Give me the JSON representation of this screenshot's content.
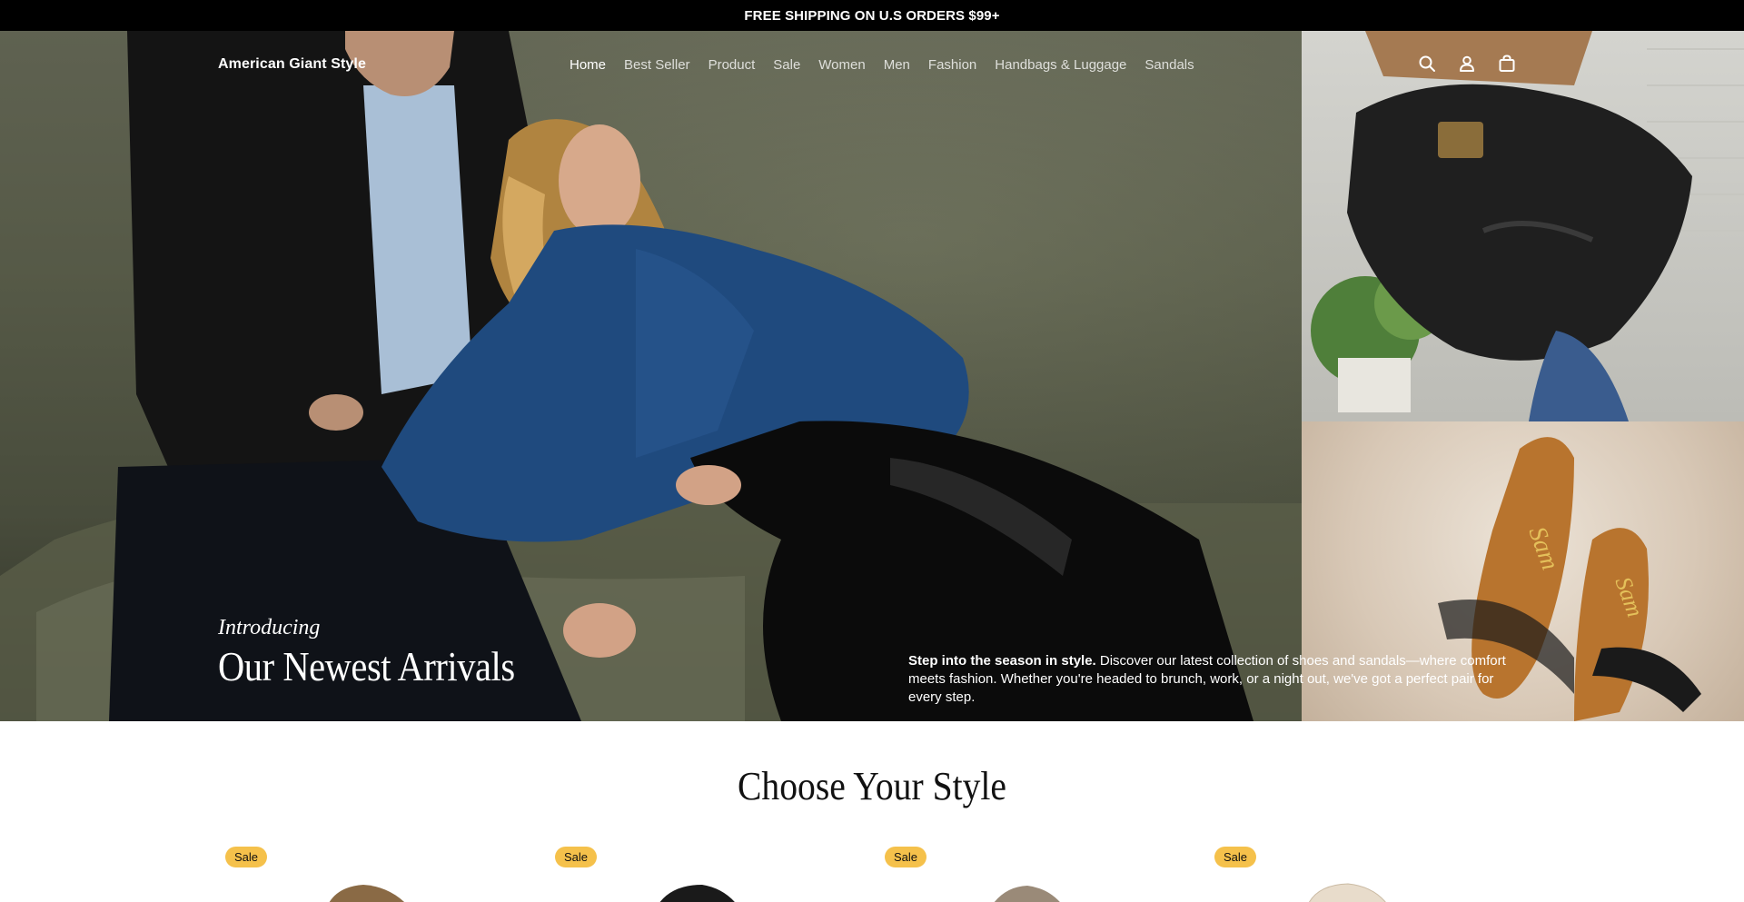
{
  "announcement": "FREE SHIPPING ON U.S ORDERS $99+",
  "brand": "American Giant Style",
  "nav": {
    "items": [
      "Home",
      "Best Seller",
      "Product",
      "Sale",
      "Women",
      "Men",
      "Fashion",
      "Handbags & Luggage",
      "Sandals"
    ],
    "active": "Home",
    "icons": [
      "search-icon",
      "account-icon",
      "cart-icon"
    ]
  },
  "hero": {
    "intro": "Introducing",
    "headline": "Our Newest Arrivals",
    "description_bold": "Step into the season in style.",
    "description": " Discover our latest collection of shoes and sandals—where comfort meets fashion. Whether you're headed to brunch, work, or a night out, we've got a perfect pair for every step."
  },
  "section": {
    "title": "Choose Your Style"
  },
  "products": [
    {
      "badge": "Sale"
    },
    {
      "badge": "Sale"
    },
    {
      "badge": "Sale"
    },
    {
      "badge": "Sale"
    }
  ],
  "colors": {
    "announcement_bg": "#000000",
    "badge": "#f5c14b",
    "text": "#111111"
  }
}
